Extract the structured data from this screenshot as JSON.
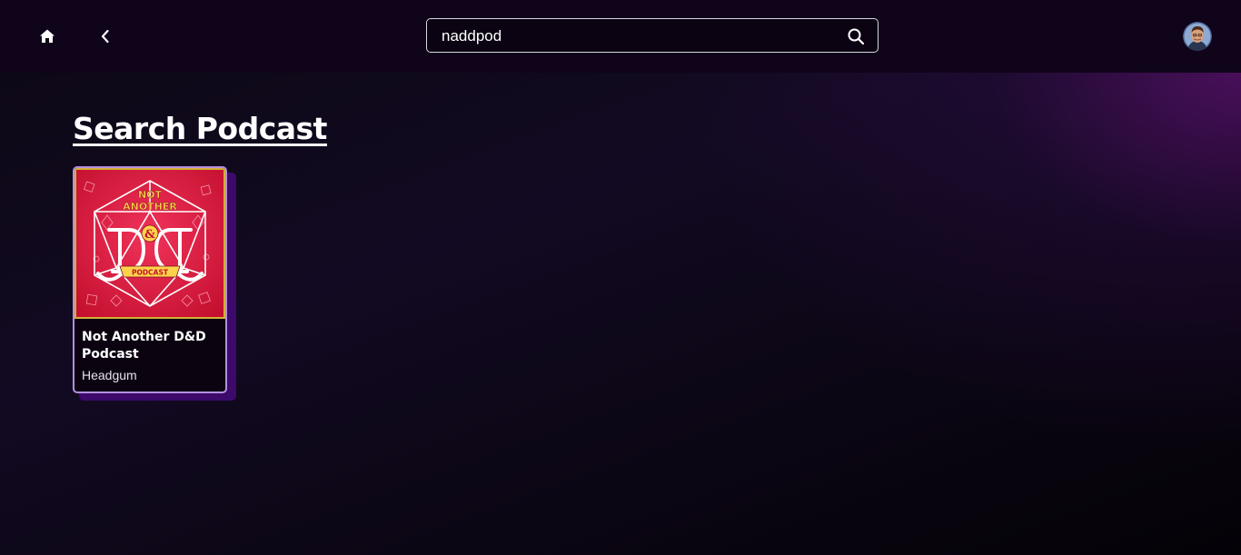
{
  "header": {
    "search": {
      "value": "naddpod",
      "placeholder": ""
    },
    "icons": {
      "home": "home-icon",
      "back": "chevron-left-icon",
      "search": "search-icon",
      "avatar": "user-avatar"
    }
  },
  "main": {
    "title": "Search Podcast",
    "results": [
      {
        "title": "Not Another D&D Podcast",
        "author": "Headgum",
        "cover": {
          "line1": "NOT",
          "line2": "ANOTHER",
          "ampersand": "&",
          "banner": "PODCAST"
        }
      }
    ]
  },
  "colors": {
    "topbar": "#10041a",
    "card_border": "#b48fe0",
    "card_shadow": "#3d0a6b",
    "cover_red": "#e0173f",
    "cover_gold": "#c9a227"
  }
}
